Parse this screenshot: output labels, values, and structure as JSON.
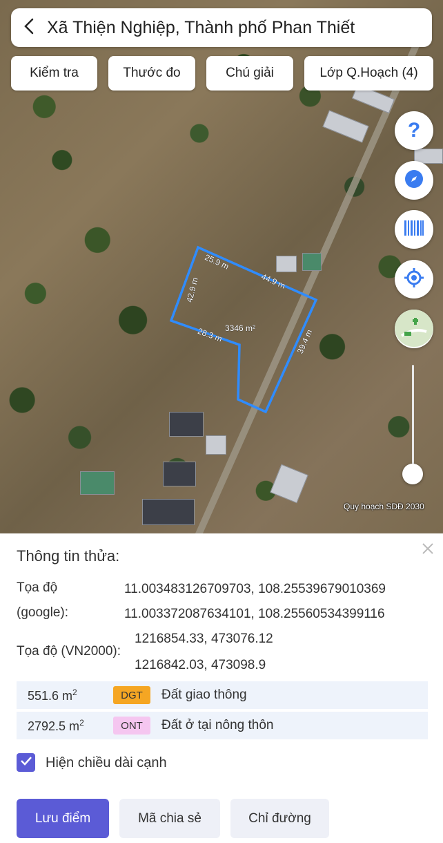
{
  "search": {
    "title": "Xã Thiện Nghiệp, Thành phố Phan Thiết"
  },
  "toolbar": {
    "items": [
      "Kiểm tra",
      "Thước đo",
      "Chú giải",
      "Lớp Q.Hoạch (4)"
    ]
  },
  "map": {
    "credit": "Quy hoạch SDĐ 2030",
    "parcel": {
      "area": "3346 m²",
      "edges": [
        "25.9 m",
        "44.9 m",
        "42.9 m",
        "28.3 m",
        "39.4 m"
      ]
    },
    "controls": [
      "help-icon",
      "compass-icon",
      "barcode-icon",
      "my-location-icon",
      "layer-thumbnail"
    ],
    "zoom_level": 0.1
  },
  "panel": {
    "title": "Thông tin thửa:",
    "coord_google_label_1": "Tọa độ",
    "coord_google_label_2": "(google):",
    "coord_google_1": "11.003483126709703, 108.25539679010369",
    "coord_google_2": "11.003372087634101, 108.25560534399116",
    "coord_vn2000_label": "Tọa độ (VN2000):",
    "coord_vn2000_1": "1216854.33, 473076.12",
    "coord_vn2000_2": "1216842.03, 473098.9",
    "land_uses": [
      {
        "area": "551.6 m",
        "unit_sup": "2",
        "code": "DGT",
        "name": "Đất giao thông",
        "color": "#f5a623"
      },
      {
        "area": "2792.5 m",
        "unit_sup": "2",
        "code": "ONT",
        "name": "Đất ở tại nông thôn",
        "color": "#f5c6f0"
      }
    ],
    "show_edges_label": "Hiện chiều dài cạnh",
    "show_edges_checked": true,
    "buttons": {
      "save": "Lưu điểm",
      "share": "Mã chia sẻ",
      "directions": "Chỉ đường"
    }
  },
  "colors": {
    "accent": "#5b5bd6",
    "parcel_outline": "#2f8cff"
  }
}
